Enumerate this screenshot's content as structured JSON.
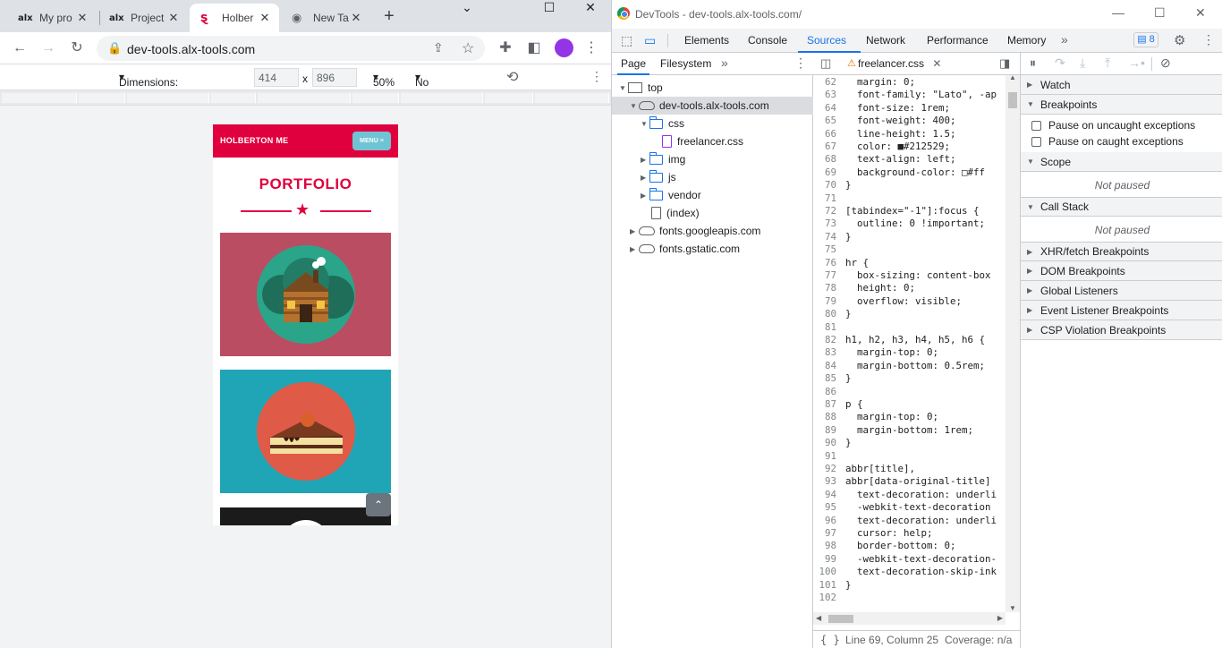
{
  "browser": {
    "tabs": [
      {
        "title": "My pro",
        "icon": "alx-favicon"
      },
      {
        "title": "Project",
        "icon": "alx-favicon"
      },
      {
        "title": "Holber",
        "icon": "holberton-favicon"
      },
      {
        "title": "New Ta",
        "icon": "chrome-favicon"
      }
    ],
    "url": "dev-tools.alx-tools.com",
    "device": {
      "dimensions_label": "Dimensions: iPhone XR",
      "width": "414",
      "height": "896",
      "times": "x",
      "zoom": "50%",
      "throttling": "No throttling"
    }
  },
  "page": {
    "brand": "HOLBERTON ME",
    "menu_label": "MENU",
    "title": "PORTFOLIO",
    "colors": {
      "primary": "#e0003d",
      "card1": "#bb4d62",
      "card2": "#1fa5b6",
      "menu": "#6fc4d4"
    }
  },
  "devtools": {
    "title": "DevTools - dev-tools.alx-tools.com/",
    "tabs": [
      "Elements",
      "Console",
      "Sources",
      "Network",
      "Performance",
      "Memory"
    ],
    "active_tab": "Sources",
    "issues_count": "8",
    "navigator": {
      "tabs": [
        "Page",
        "Filesystem"
      ],
      "tree": [
        {
          "label": "top",
          "type": "frame"
        },
        {
          "label": "dev-tools.alx-tools.com",
          "type": "cloud"
        },
        {
          "label": "css",
          "type": "folder"
        },
        {
          "label": "freelancer.css",
          "type": "file"
        },
        {
          "label": "img",
          "type": "folder"
        },
        {
          "label": "js",
          "type": "folder"
        },
        {
          "label": "vendor",
          "type": "folder"
        },
        {
          "label": "(index)",
          "type": "file"
        },
        {
          "label": "fonts.googleapis.com",
          "type": "cloud"
        },
        {
          "label": "fonts.gstatic.com",
          "type": "cloud"
        }
      ]
    },
    "editor": {
      "file_tab": "freelancer.css",
      "lines": [
        {
          "n": "62",
          "t": "  margin: 0;"
        },
        {
          "n": "63",
          "t": "  font-family: \"Lato\", -ap"
        },
        {
          "n": "64",
          "t": "  font-size: 1rem;"
        },
        {
          "n": "65",
          "t": "  font-weight: 400;"
        },
        {
          "n": "66",
          "t": "  line-height: 1.5;"
        },
        {
          "n": "67",
          "t": "  color: ■#212529;"
        },
        {
          "n": "68",
          "t": "  text-align: left;"
        },
        {
          "n": "69",
          "t": "  background-color: □#ff"
        },
        {
          "n": "70",
          "t": "}"
        },
        {
          "n": "71",
          "t": ""
        },
        {
          "n": "72",
          "t": "[tabindex=\"-1\"]:focus {"
        },
        {
          "n": "73",
          "t": "  outline: 0 !important;"
        },
        {
          "n": "74",
          "t": "}"
        },
        {
          "n": "75",
          "t": ""
        },
        {
          "n": "76",
          "t": "hr {"
        },
        {
          "n": "77",
          "t": "  box-sizing: content-box"
        },
        {
          "n": "78",
          "t": "  height: 0;"
        },
        {
          "n": "79",
          "t": "  overflow: visible;"
        },
        {
          "n": "80",
          "t": "}"
        },
        {
          "n": "81",
          "t": ""
        },
        {
          "n": "82",
          "t": "h1, h2, h3, h4, h5, h6 {"
        },
        {
          "n": "83",
          "t": "  margin-top: 0;"
        },
        {
          "n": "84",
          "t": "  margin-bottom: 0.5rem;"
        },
        {
          "n": "85",
          "t": "}"
        },
        {
          "n": "86",
          "t": ""
        },
        {
          "n": "87",
          "t": "p {"
        },
        {
          "n": "88",
          "t": "  margin-top: 0;"
        },
        {
          "n": "89",
          "t": "  margin-bottom: 1rem;"
        },
        {
          "n": "90",
          "t": "}"
        },
        {
          "n": "91",
          "t": ""
        },
        {
          "n": "92",
          "t": "abbr[title],"
        },
        {
          "n": "93",
          "t": "abbr[data-original-title]"
        },
        {
          "n": "94",
          "t": "  text-decoration: underli"
        },
        {
          "n": "95",
          "t": "  -webkit-text-decoration"
        },
        {
          "n": "96",
          "t": "  text-decoration: underli"
        },
        {
          "n": "97",
          "t": "  cursor: help;"
        },
        {
          "n": "98",
          "t": "  border-bottom: 0;"
        },
        {
          "n": "99",
          "t": "  -webkit-text-decoration-"
        },
        {
          "n": "100",
          "t": "  text-decoration-skip-ink"
        },
        {
          "n": "101",
          "t": "}"
        },
        {
          "n": "102",
          "t": ""
        }
      ],
      "status_position": "Line 69, Column 25",
      "status_coverage": "Coverage: n/a",
      "status_icon": "{ }"
    },
    "debugger": {
      "sections": {
        "watch": "Watch",
        "breakpoints": "Breakpoints",
        "pause_uncaught": "Pause on uncaught exceptions",
        "pause_caught": "Pause on caught exceptions",
        "scope": "Scope",
        "scope_status": "Not paused",
        "call_stack": "Call Stack",
        "call_stack_status": "Not paused",
        "xhr": "XHR/fetch Breakpoints",
        "dom": "DOM Breakpoints",
        "global": "Global Listeners",
        "event": "Event Listener Breakpoints",
        "csp": "CSP Violation Breakpoints"
      }
    }
  }
}
